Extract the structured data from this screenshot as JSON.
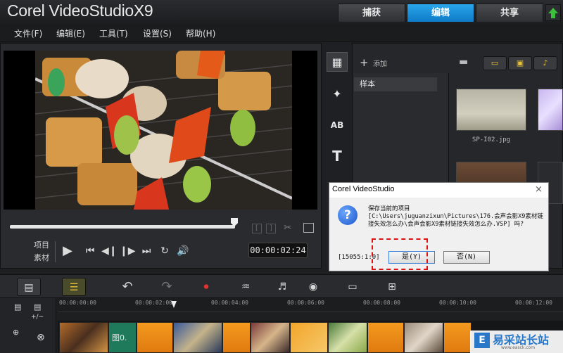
{
  "window": {
    "app_title": "Corel VideoStudioX9",
    "mode_tabs": [
      {
        "label": "捕获",
        "active": false
      },
      {
        "label": "编辑",
        "active": true
      },
      {
        "label": "共享",
        "active": false
      }
    ]
  },
  "menu": {
    "items": [
      "文件(F)",
      "编辑(E)",
      "工具(T)",
      "设置(S)",
      "帮助(H)"
    ]
  },
  "player": {
    "mode_labels": {
      "project": "项目",
      "clip": "素材"
    },
    "timecode": "00:00:02:24",
    "scrub_position_fraction": 0.84
  },
  "library": {
    "add_label": "添加",
    "folder_sample": "样本",
    "thumb_caption": "SP-I02.jpg",
    "side_icons": {
      "text": "AB",
      "title": "T"
    }
  },
  "dialog": {
    "title": "Corel VideoStudio",
    "icon_glyph": "?",
    "message": "保存当前的项目\n[C:\\Users\\juguanzixun\\Pictures\\176.会声会影X9素材链接失效怎么办\\会声会影X9素材链接失效怎么办.VSP] 吗?",
    "code": "[15055:1:0]",
    "yes_label": "是(Y)",
    "no_label": "否(N)",
    "close_glyph": "×"
  },
  "timeline": {
    "ruler": [
      "00:00:00:00",
      "00:00:02:00",
      "00:00:04:00",
      "00:00:06:00",
      "00:00:08:00",
      "00:00:10:00",
      "00:00:12:00"
    ],
    "clip_label": "图0."
  },
  "watermark": {
    "brand": "易采站长站",
    "logo": "E",
    "url": "www.easck.com"
  }
}
